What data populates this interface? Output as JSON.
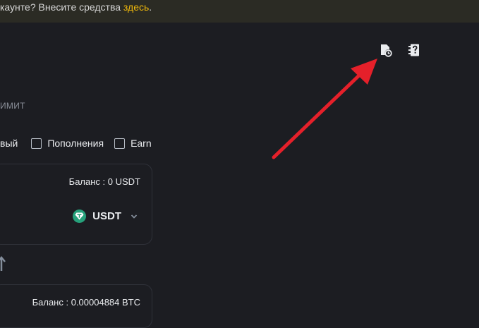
{
  "banner": {
    "text": "каунте? Внесите средства ",
    "link": "здесь",
    "suffix": "."
  },
  "header_icons": {
    "history": "order-history-icon",
    "help": "help-icon"
  },
  "limit_label": "ИМИТ",
  "filters": {
    "partial_label": "вый",
    "items": [
      {
        "label": "Пополнения",
        "checked": false
      },
      {
        "label": "Earn",
        "checked": false
      }
    ]
  },
  "from_card": {
    "balance": "Баланс : 0 USDT",
    "coin": "USDT",
    "coin_icon": "usdt-logo"
  },
  "to_card": {
    "balance": "Баланс : 0.00004884 BTC"
  },
  "colors": {
    "accent": "#f0b90b",
    "annotation": "#e5202a",
    "usdt": "#26a17b"
  }
}
